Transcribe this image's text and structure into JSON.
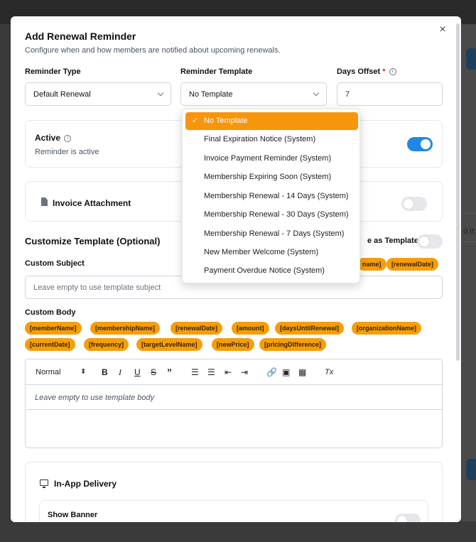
{
  "modal": {
    "title": "Add Renewal Reminder",
    "subtitle": "Configure when and how members are notified about upcoming renewals.",
    "close_glyph": "×"
  },
  "fields": {
    "reminder_type": {
      "label": "Reminder Type",
      "value": "Default Renewal"
    },
    "reminder_template": {
      "label": "Reminder Template",
      "value": "No Template"
    },
    "days_offset": {
      "label": "Days Offset",
      "required_mark": "*",
      "value": "7"
    }
  },
  "active": {
    "label": "Active",
    "description": "Reminder is active",
    "enabled": true
  },
  "invoice_attachment": {
    "label": "Invoice Attachment",
    "icon": "document-icon",
    "enabled": false
  },
  "customize": {
    "heading": "Customize Template (Optional)",
    "save_as_template_label": "e as Template",
    "custom_subject_label": "Custom Subject",
    "custom_subject_placeholder": "Leave empty to use template subject",
    "subject_chips": [
      "name]",
      "[renewalDate]"
    ],
    "custom_body_label": "Custom Body",
    "body_chips_row1": [
      "[memberName]",
      "[membershipName]",
      "[renewalDate]",
      "[amount]",
      "[daysUntilRenewal]",
      "[organizationName]"
    ],
    "body_chips_row2": [
      "[currentDate]",
      "[frequency]",
      "[targetLevelName]",
      "[newPrice]",
      "[pricingDifference]"
    ],
    "editor_placeholder": "Leave empty to use template body",
    "toolbar": {
      "format": "Normal",
      "bold": "B",
      "italic": "I",
      "underline": "U",
      "strike": "S",
      "quote": "”",
      "clean": "Tx"
    }
  },
  "in_app": {
    "heading": "In-App Delivery",
    "show_banner_label": "Show Banner"
  },
  "dropdown": {
    "selected_index": 0,
    "check_glyph": "✓",
    "options": [
      "No Template",
      "Final Expiration Notice (System)",
      "Invoice Payment Reminder (System)",
      "Membership Expiring Soon (System)",
      "Membership Renewal - 14 Days (System)",
      "Membership Renewal - 30 Days (System)",
      "Membership Renewal - 7 Days (System)",
      "New Member Welcome (System)",
      "Payment Overdue Notice (System)"
    ]
  },
  "background": {
    "partial_text": "d It"
  },
  "colors": {
    "accent": "#f7950c",
    "toggle_on": "#1e88e5",
    "chip": "#f59e0b"
  }
}
